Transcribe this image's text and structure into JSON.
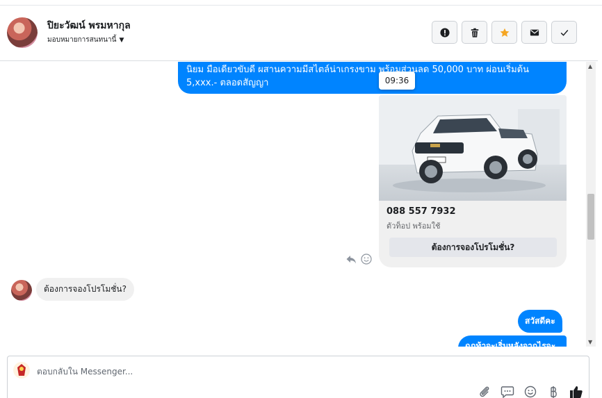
{
  "header": {
    "contact_name": "ปิยะวัฒน์ พรมหากุล",
    "assign_label": "มอบหมายการสนทนานี้",
    "buttons": [
      "alert-icon",
      "trash-icon",
      "star-icon",
      "envelope-icon",
      "check-icon"
    ],
    "star_color": "#f5a623"
  },
  "messages": {
    "top_line1": "นิยม มือเดียวขับดี ผสานความมีสไตล์น่าเกรงขาม พร้อมส่วนลด 50,000 บาท ผ่อนเริ่มต้น",
    "top_line2": "5,xxx.- ตลอดสัญญา",
    "tooltip_time": "09:36",
    "card": {
      "title": "088 557 7932",
      "subtitle": "ตัวท็อป พร้อมใช้",
      "button_label": "ต้องการจองโปรโมชั่น?"
    },
    "incoming_reply": "ต้องการจองโปรโมชั่น?",
    "out_hello": "สวัสดีคะ",
    "out_partial": "ฉกท้าจะเริ่มหลังจากไรจะ"
  },
  "composer": {
    "placeholder": "ตอบกลับใน Messenger..."
  },
  "colors": {
    "outgoing_bubble": "#0084ff",
    "incoming_bubble": "#f0f0f0",
    "like_icon": "#1c1e21"
  }
}
